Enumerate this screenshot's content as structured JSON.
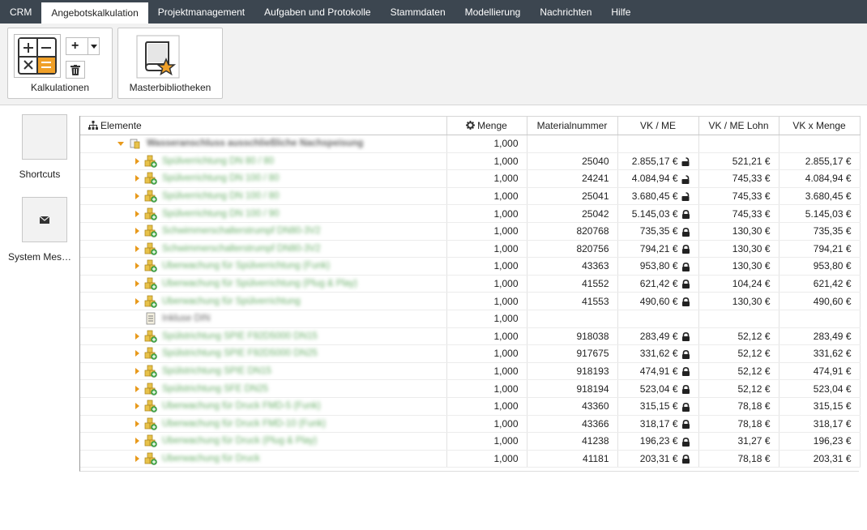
{
  "menu": {
    "items": [
      {
        "label": "CRM",
        "active": false
      },
      {
        "label": "Angebotskalkulation",
        "active": true
      },
      {
        "label": "Projektmanagement",
        "active": false
      },
      {
        "label": "Aufgaben und Protokolle",
        "active": false
      },
      {
        "label": "Stammdaten",
        "active": false
      },
      {
        "label": "Modellierung",
        "active": false
      },
      {
        "label": "Nachrichten",
        "active": false
      },
      {
        "label": "Hilfe",
        "active": false
      }
    ]
  },
  "ribbon": {
    "kalkulationen_label": "Kalkulationen",
    "masterbibliotheken_label": "Masterbibliotheken",
    "add_glyph": "+",
    "delete_icon": "trash-icon"
  },
  "sidebar": {
    "shortcuts_label": "Shortcuts",
    "system_label": "System Mes…"
  },
  "grid": {
    "headers": {
      "elemente": "Elemente",
      "menge": "Menge",
      "materialnummer": "Materialnummer",
      "vk_me": "VK / ME",
      "vk_me_lohn": "VK / ME Lohn",
      "vk_menge": "VK x Menge"
    },
    "colors": {
      "accent": "#e89a1c",
      "menubar": "#3c4650",
      "blurred_green": "#6ab06a"
    },
    "rows": [
      {
        "type": "root",
        "name": "Wasseranschluss ausschließliche Nachspeisung",
        "menge": "1,000",
        "mat": "",
        "vk": "",
        "lock": "",
        "lohn": "",
        "total": ""
      },
      {
        "type": "item",
        "name": "Spülverrichtung DN 80 / 80",
        "menge": "1,000",
        "mat": "25040",
        "vk": "2.855,17 €",
        "lock": "open",
        "lohn": "521,21 €",
        "total": "2.855,17 €"
      },
      {
        "type": "item",
        "name": "Spülverrichtung DN 100 / 80",
        "menge": "1,000",
        "mat": "24241",
        "vk": "4.084,94 €",
        "lock": "open",
        "lohn": "745,33 €",
        "total": "4.084,94 €"
      },
      {
        "type": "item",
        "name": "Spülverrichtung DN 100 / 80",
        "menge": "1,000",
        "mat": "25041",
        "vk": "3.680,45 €",
        "lock": "open",
        "lohn": "745,33 €",
        "total": "3.680,45 €"
      },
      {
        "type": "item",
        "name": "Spülverrichtung DN 100 / 90",
        "menge": "1,000",
        "mat": "25042",
        "vk": "5.145,03 €",
        "lock": "closed",
        "lohn": "745,33 €",
        "total": "5.145,03 €"
      },
      {
        "type": "item",
        "name": "Schwimmerschalterstrumpf DN80-3V2",
        "menge": "1,000",
        "mat": "820768",
        "vk": "735,35 €",
        "lock": "closed",
        "lohn": "130,30 €",
        "total": "735,35 €"
      },
      {
        "type": "item",
        "name": "Schwimmerschalterstrumpf DN80-3V2",
        "menge": "1,000",
        "mat": "820756",
        "vk": "794,21 €",
        "lock": "closed",
        "lohn": "130,30 €",
        "total": "794,21 €"
      },
      {
        "type": "item",
        "name": "Überwachung für Spülverrichtung (Funk)",
        "menge": "1,000",
        "mat": "43363",
        "vk": "953,80 €",
        "lock": "closed",
        "lohn": "130,30 €",
        "total": "953,80 €"
      },
      {
        "type": "item",
        "name": "Überwachung für Spülverrichtung (Plug & Play)",
        "menge": "1,000",
        "mat": "41552",
        "vk": "621,42 €",
        "lock": "closed",
        "lohn": "104,24 €",
        "total": "621,42 €"
      },
      {
        "type": "item",
        "name": "Überwachung für Spülverrichtung",
        "menge": "1,000",
        "mat": "41553",
        "vk": "490,60 €",
        "lock": "closed",
        "lohn": "130,30 €",
        "total": "490,60 €"
      },
      {
        "type": "doc",
        "name": "Inkluse DIN",
        "menge": "1,000",
        "mat": "",
        "vk": "",
        "lock": "",
        "lohn": "",
        "total": ""
      },
      {
        "type": "item",
        "name": "Spülstrichtung SPIE F92D5000 DN15",
        "menge": "1,000",
        "mat": "918038",
        "vk": "283,49 €",
        "lock": "closed",
        "lohn": "52,12 €",
        "total": "283,49 €"
      },
      {
        "type": "item",
        "name": "Spülstrichtung SPIE F92D5000 DN25",
        "menge": "1,000",
        "mat": "917675",
        "vk": "331,62 €",
        "lock": "closed",
        "lohn": "52,12 €",
        "total": "331,62 €"
      },
      {
        "type": "item",
        "name": "Spülstrichtung SPIE DN15",
        "menge": "1,000",
        "mat": "918193",
        "vk": "474,91 €",
        "lock": "closed",
        "lohn": "52,12 €",
        "total": "474,91 €"
      },
      {
        "type": "item",
        "name": "Spülstrichtung SFE DN25",
        "menge": "1,000",
        "mat": "918194",
        "vk": "523,04 €",
        "lock": "closed",
        "lohn": "52,12 €",
        "total": "523,04 €"
      },
      {
        "type": "item",
        "name": "Überwachung für Druck FMD-5 (Funk)",
        "menge": "1,000",
        "mat": "43360",
        "vk": "315,15 €",
        "lock": "closed",
        "lohn": "78,18 €",
        "total": "315,15 €"
      },
      {
        "type": "item",
        "name": "Überwachung für Druck FMD-10 (Funk)",
        "menge": "1,000",
        "mat": "43366",
        "vk": "318,17 €",
        "lock": "closed",
        "lohn": "78,18 €",
        "total": "318,17 €"
      },
      {
        "type": "item",
        "name": "Überwachung für Druck (Plug & Play)",
        "menge": "1,000",
        "mat": "41238",
        "vk": "196,23 €",
        "lock": "closed",
        "lohn": "31,27 €",
        "total": "196,23 €"
      },
      {
        "type": "item",
        "name": "Überwachung für Druck",
        "menge": "1,000",
        "mat": "41181",
        "vk": "203,31 €",
        "lock": "closed",
        "lohn": "78,18 €",
        "total": "203,31 €"
      }
    ]
  }
}
